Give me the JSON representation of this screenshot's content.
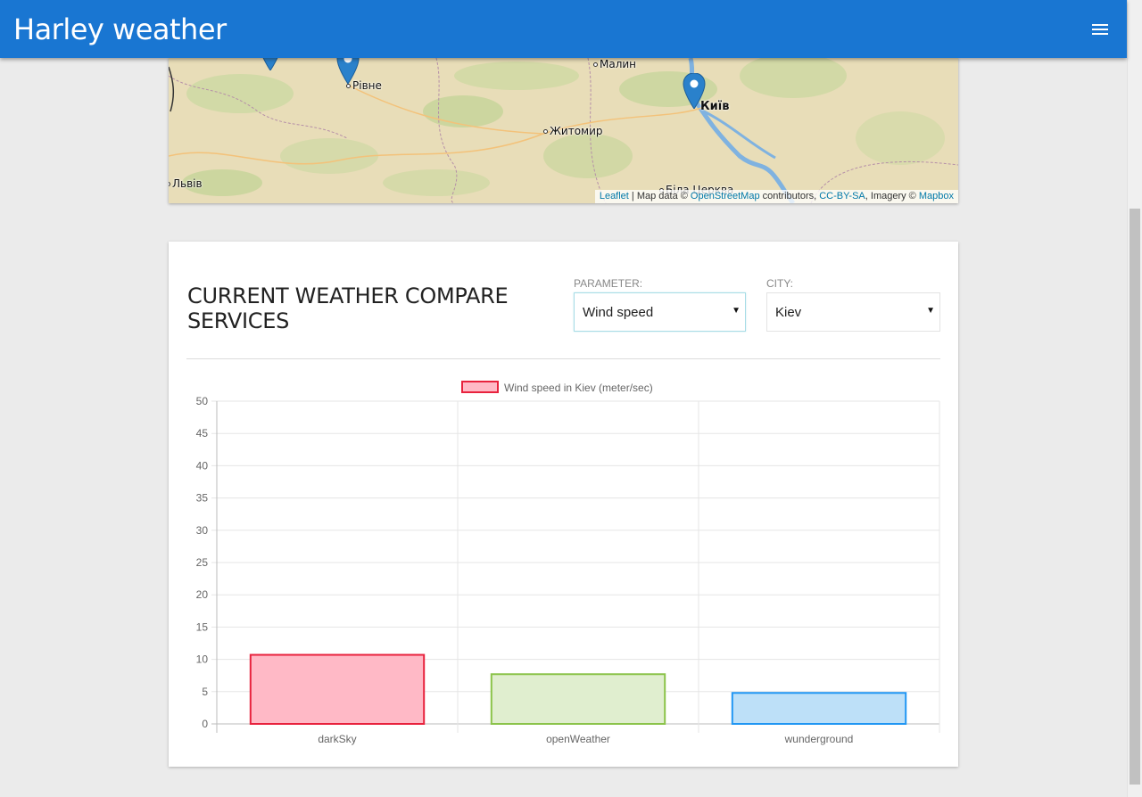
{
  "app": {
    "title": "Harley weather",
    "menu_icon": "menu-icon"
  },
  "map": {
    "cities": [
      {
        "name": "Малин",
        "size": "small"
      },
      {
        "name": "Рівне",
        "size": "medium"
      },
      {
        "name": "Київ",
        "size": "big"
      },
      {
        "name": "Житомир",
        "size": "medium"
      },
      {
        "name": "Львів",
        "size": "medium"
      },
      {
        "name": "Біла Церква",
        "size": "small"
      }
    ],
    "attribution": {
      "leaflet": "Leaflet",
      "sep": " | Map data © ",
      "osm": "OpenStreetMap",
      "contributors": " contributors, ",
      "license": "CC-BY-SA",
      "imagery": ", Imagery © ",
      "mapbox": "Mapbox"
    }
  },
  "compare": {
    "title": "CURRENT WEATHER COMPARE SERVICES",
    "parameter_label": "PARAMETER:",
    "parameter_value": "Wind speed",
    "city_label": "CITY:",
    "city_value": "Kiev"
  },
  "chart_data": {
    "type": "bar",
    "title": "",
    "legend": "Wind speed in Kiev (meter/sec)",
    "legend_position": "top",
    "categories": [
      "darkSky",
      "openWeather",
      "wunderground"
    ],
    "values": [
      10.7,
      7.7,
      4.8
    ],
    "ylim": [
      0,
      50
    ],
    "yticks": [
      0,
      5,
      10,
      15,
      20,
      25,
      30,
      35,
      40,
      45,
      50
    ],
    "grid": true,
    "colors": {
      "fill": [
        "#ffb9c6",
        "#e0eecf",
        "#bde0f8"
      ],
      "stroke": [
        "#e8223d",
        "#8bc34a",
        "#2196f3"
      ],
      "legend_fill": "#ffb9c6",
      "legend_stroke": "#e8223d"
    }
  },
  "colors": {
    "appbar": "#1976d2",
    "background": "#ebebeb"
  }
}
